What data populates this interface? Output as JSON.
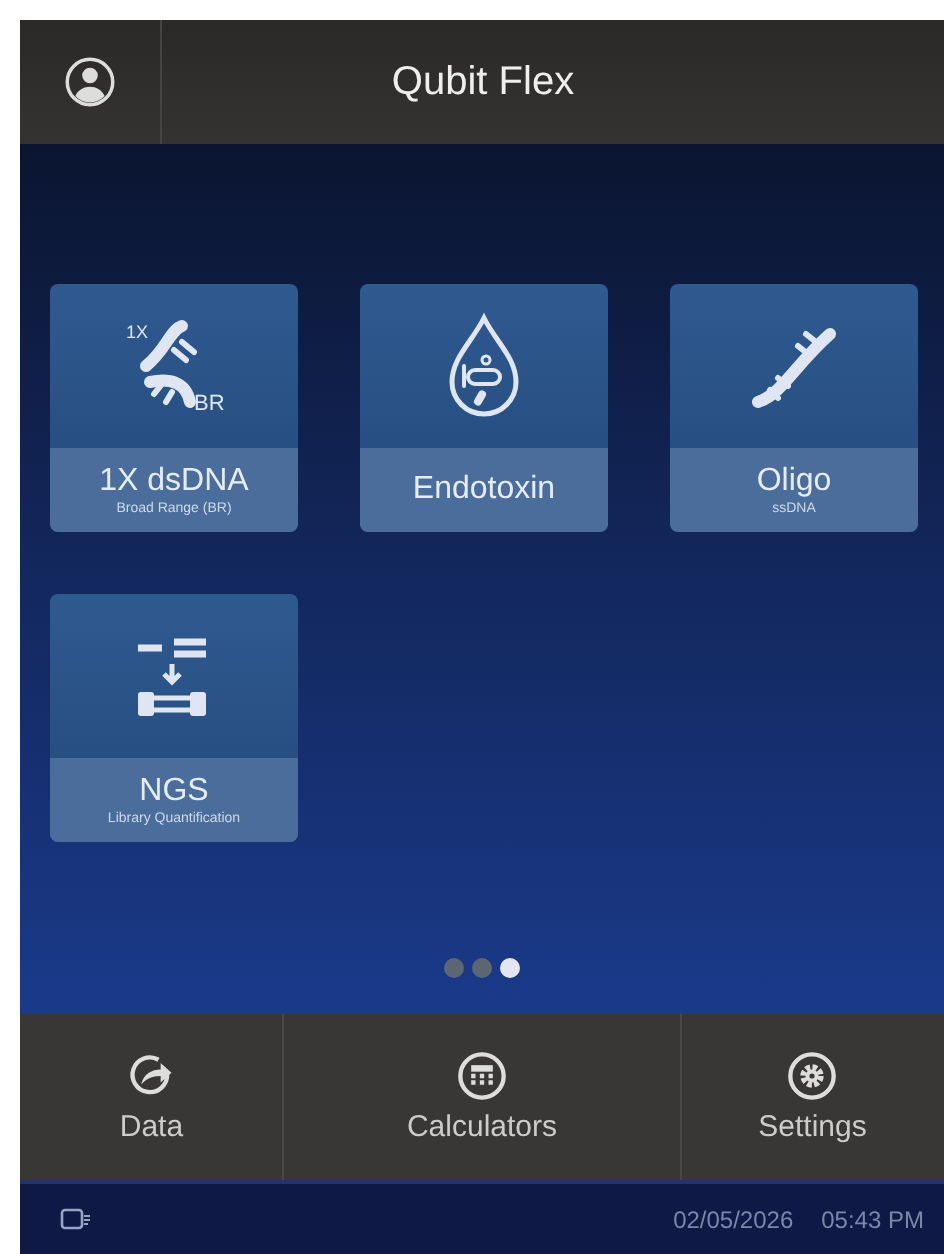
{
  "header": {
    "title": "Qubit Flex"
  },
  "assays": [
    {
      "kind": "dsdna",
      "name": "1X dsDNA",
      "subtitle": "Broad Range (BR)",
      "icon_texts": [
        "1X",
        "BR"
      ]
    },
    {
      "kind": "endotoxin",
      "name": "Endotoxin"
    },
    {
      "kind": "oligo",
      "name": "Oligo",
      "subtitle": "ssDNA"
    },
    {
      "kind": "ngs",
      "name": "NGS",
      "subtitle": "Library Quantification"
    }
  ],
  "pager": [
    {
      "selected": false
    },
    {
      "selected": false
    },
    {
      "selected": true
    }
  ],
  "nav": [
    {
      "kind": "data",
      "label": "Data"
    },
    {
      "kind": "calculators",
      "label": "Calculators"
    },
    {
      "kind": "settings",
      "label": "Settings"
    }
  ],
  "status_bar": {
    "date": "02/05/2026",
    "time": "05:43 PM"
  }
}
